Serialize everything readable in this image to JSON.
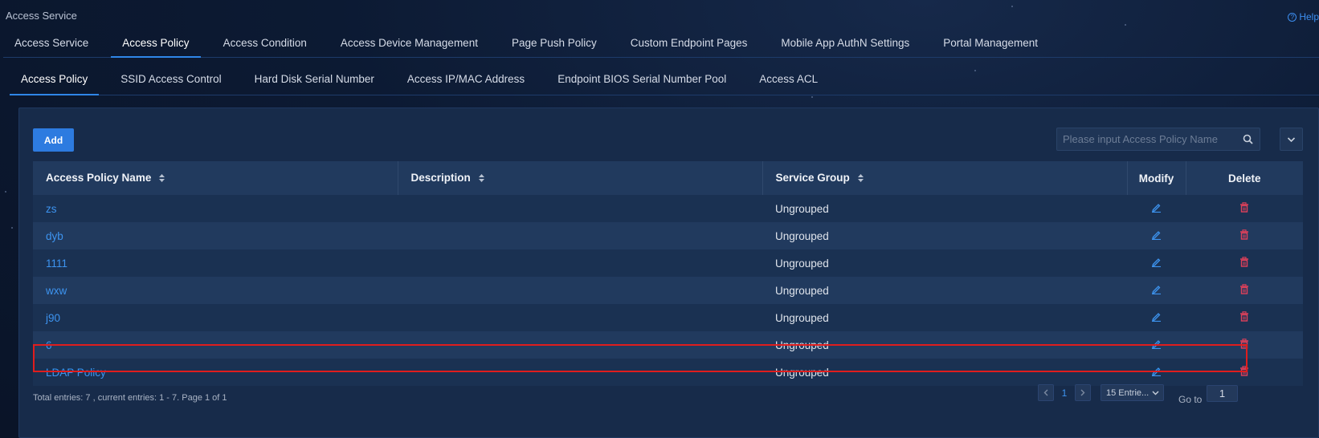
{
  "app": {
    "title": "Access Service",
    "help": "Help"
  },
  "top_tabs": [
    "Access Service",
    "Access Policy",
    "Access Condition",
    "Access Device Management",
    "Page Push Policy",
    "Custom Endpoint Pages",
    "Mobile App AuthN Settings",
    "Portal Management"
  ],
  "top_tabs_active": "Access Policy",
  "sub_tabs": [
    "Access Policy",
    "SSID Access Control",
    "Hard Disk Serial Number",
    "Access IP/MAC Address",
    "Endpoint BIOS Serial Number Pool",
    "Access ACL"
  ],
  "sub_tabs_active": "Access Policy",
  "toolbar": {
    "add_label": "Add",
    "search_placeholder": "Please input Access Policy Name"
  },
  "table": {
    "headers": {
      "name": "Access Policy Name",
      "description": "Description",
      "service_group": "Service Group",
      "modify": "Modify",
      "delete": "Delete"
    },
    "rows": [
      {
        "name": "zs",
        "description": "",
        "service_group": "Ungrouped"
      },
      {
        "name": "dyb",
        "description": "",
        "service_group": "Ungrouped"
      },
      {
        "name": "1111",
        "description": "",
        "service_group": "Ungrouped"
      },
      {
        "name": "wxw",
        "description": "",
        "service_group": "Ungrouped"
      },
      {
        "name": "j90",
        "description": "",
        "service_group": "Ungrouped"
      },
      {
        "name": "6",
        "description": "",
        "service_group": "Ungrouped"
      },
      {
        "name": "LDAP Policy",
        "description": "",
        "service_group": "Ungrouped"
      }
    ]
  },
  "footer": {
    "summary": "Total entries: 7 , current entries: 1 - 7. Page 1 of 1",
    "current_page": "1",
    "page_size": "15 Entrie...",
    "goto_label": "Go to",
    "goto_value": "1"
  },
  "colors": {
    "accent": "#2d7be0",
    "link": "#3d94f0",
    "delete": "#e0405a",
    "highlight": "#e01d1d"
  }
}
